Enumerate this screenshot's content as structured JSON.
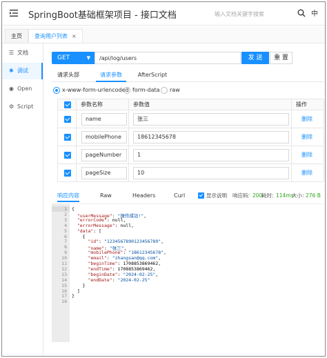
{
  "header": {
    "title": "SpringBoot基础框架项目 - 接口文档",
    "search_placeholder": "输入文档关键字搜索",
    "lang_label": "中"
  },
  "tabs": [
    {
      "label": "主页"
    },
    {
      "label": "查询用户列表",
      "close": "×"
    }
  ],
  "sidebar": {
    "items": [
      {
        "label": "文档",
        "icon": "doc-icon"
      },
      {
        "label": "调试",
        "icon": "debug-icon"
      },
      {
        "label": "Open",
        "icon": "open-icon"
      },
      {
        "label": "Script",
        "icon": "script-icon"
      }
    ]
  },
  "request": {
    "method": "GET",
    "url": "/api/log/users",
    "send_label": "发 送",
    "reset_label": "重 置",
    "tabs": [
      "请求头部",
      "请求参数",
      "AfterScript"
    ],
    "active_tab": "请求参数",
    "body_types": [
      "x-www-form-urlencoded",
      "form-data",
      "raw"
    ],
    "selected_body_type": "x-www-form-urlencoded"
  },
  "params_table": {
    "headers": {
      "name": "参数名称",
      "value": "参数值",
      "op": "操作"
    },
    "delete_label": "删除",
    "rows": [
      {
        "name": "name",
        "value": "张三"
      },
      {
        "name": "mobilePhone",
        "value": "18612345678"
      },
      {
        "name": "pageNumber",
        "value": "1"
      },
      {
        "name": "pageSize",
        "value": "10"
      }
    ]
  },
  "response": {
    "tabs": [
      "响应内容",
      "Raw",
      "Headers",
      "Curl"
    ],
    "active_tab": "响应内容",
    "show_desc_label": "显示说明",
    "status_label": "响应码:",
    "status_value": "200",
    "time_label": "耗时:",
    "time_value": "114ms",
    "size_label": "大小:",
    "size_value": "276 B",
    "line_numbers": [
      "1",
      "2",
      "3",
      "4",
      "5",
      "6",
      "7",
      "8",
      "9",
      "10",
      "11",
      "12",
      "13",
      "14",
      "15",
      "16",
      "17",
      "18"
    ],
    "code_lines": [
      "{",
      "  \"userMessage\": \"操作成功!\",",
      "  \"errorCode\": null,",
      "  \"errorMessage\": null,",
      "  \"data\": [",
      "    {",
      "      \"id\": \"1234567890123456789\",",
      "      \"name\": \"张三\",",
      "      \"mobilePhone\": \"18612345678\",",
      "      \"email\": \"zhangsan@qq.com\",",
      "      \"beginTime\": 1708853869462,",
      "      \"endTime\": 1708853869462,",
      "      \"beginDate\": \"2024-02-25\",",
      "      \"endDate\": \"2024-02-25\"",
      "    }",
      "  ]",
      "}",
      ""
    ]
  },
  "colors": {
    "accent": "#1890ff",
    "success": "#2aa515"
  }
}
